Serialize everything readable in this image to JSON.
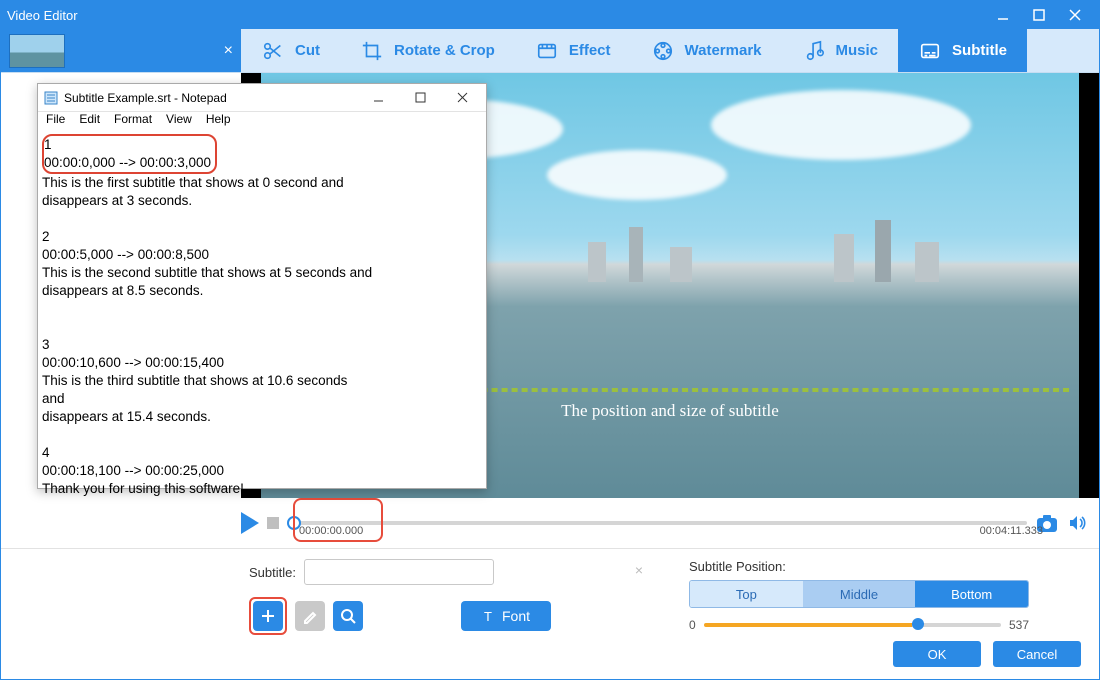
{
  "window": {
    "title": "Video Editor"
  },
  "toolbar": {
    "items": [
      {
        "label": "Cut",
        "icon": "scissors-icon"
      },
      {
        "label": "Rotate & Crop",
        "icon": "crop-icon"
      },
      {
        "label": "Effect",
        "icon": "film-icon"
      },
      {
        "label": "Watermark",
        "icon": "reel-icon"
      },
      {
        "label": "Music",
        "icon": "music-icon"
      },
      {
        "label": "Subtitle",
        "icon": "subtitle-icon"
      }
    ],
    "active_index": 5
  },
  "notepad": {
    "title": "Subtitle Example.srt - Notepad",
    "menu": [
      "File",
      "Edit",
      "Format",
      "View",
      "Help"
    ],
    "body_highlight_line1": "1",
    "body_highlight_line2": "00:00:0,000 --> 00:00:3,000",
    "body_rest": "This is the first subtitle that shows at 0 second and\ndisappears at 3 seconds.\n\n2\n00:00:5,000 --> 00:00:8,500\nThis is the second subtitle that shows at 5 seconds and\ndisappears at 8.5 seconds.\n\n\n3\n00:00:10,600 --> 00:00:15,400\nThis is the third subtitle that shows at 10.6 seconds\nand\ndisappears at 15.4 seconds.\n\n4\n00:00:18,100 --> 00:00:25,000\nThank you for using this software!"
  },
  "preview": {
    "subtitle_placeholder": "The position and size of subtitle"
  },
  "transport": {
    "current_time": "00:00:00.000",
    "total_time": "00:04:11.333"
  },
  "subtitle_panel": {
    "label": "Subtitle:",
    "input_value": "",
    "font_button": "Font"
  },
  "position_panel": {
    "label": "Subtitle Position:",
    "options": [
      "Top",
      "Middle",
      "Bottom"
    ],
    "selected_index": 2,
    "slider_min": "0",
    "slider_max": "537"
  },
  "dialog": {
    "ok": "OK",
    "cancel": "Cancel"
  }
}
